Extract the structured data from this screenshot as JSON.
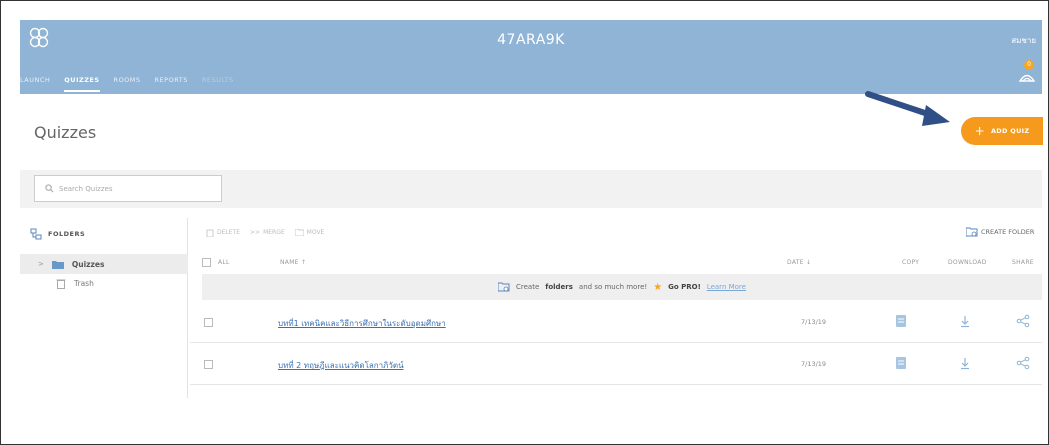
{
  "header": {
    "room_name": "47ARA9K",
    "user_name": "สมชาย",
    "notification_count": "0",
    "nav": [
      "LAUNCH",
      "QUIZZES",
      "ROOMS",
      "REPORTS",
      "RESULTS"
    ],
    "active_nav": "QUIZZES",
    "bg_color": "#8fb4d6"
  },
  "page": {
    "title": "Quizzes",
    "add_quiz_label": "ADD QUIZ",
    "accent_color": "#f59a1c"
  },
  "search": {
    "placeholder": "Search Quizzes"
  },
  "sidebar": {
    "folders_label": "FOLDERS",
    "items": [
      {
        "label": "Quizzes",
        "icon": "folder-icon"
      },
      {
        "label": "Trash",
        "icon": "trash-icon"
      }
    ]
  },
  "toolbar": {
    "delete_label": "DELETE",
    "merge_label": "MERGE",
    "move_label": "MOVE",
    "create_folder_label": "CREATE FOLDER"
  },
  "table": {
    "headers": {
      "all": "ALL",
      "name": "NAME ↑",
      "date": "DATE ↓",
      "copy": "COPY",
      "download": "DOWNLOAD",
      "share": "SHARE"
    },
    "promo": {
      "text_before": "Create",
      "bold": "folders",
      "text_after": "and so much more!",
      "go_pro": "Go PRO!",
      "learn_more": "Learn More"
    },
    "rows": [
      {
        "name": "บทที่1 เทคนิคและวิธีการศึกษาในระดับอุดมศึกษา",
        "date": "7/13/19"
      },
      {
        "name": "บทที่ 2 ทฤษฎีและแนวคิดโลกาภิวัตน์",
        "date": "7/13/19"
      }
    ]
  }
}
